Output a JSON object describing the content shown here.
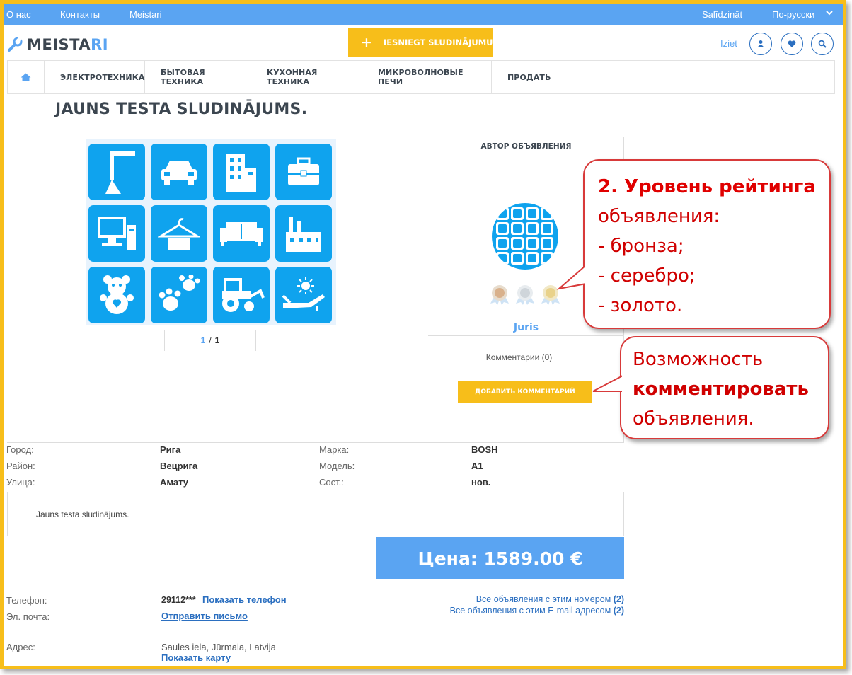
{
  "topbar": {
    "about": "О нас",
    "contacts": "Контакты",
    "brand_link": "Meistari",
    "compare": "Salīdzināt",
    "language": "По-русски"
  },
  "header": {
    "logo_text_main": "MEISTA",
    "logo_text_accent": "RI",
    "submit_ad": "IESNIEGT SLUDINĀJUMU",
    "logout": "Iziet"
  },
  "nav": {
    "items": [
      "ЭЛЕКТРОТЕХНИКА",
      "БЫТОВАЯ ТЕХНИКА",
      "КУХОННАЯ ТЕХНИКА",
      "МИКРОВОЛНОВЫЕ ПЕЧИ",
      "ПРОДАТЬ"
    ]
  },
  "ad": {
    "title": "JAUNS TESTA SLUDINĀJUMS.",
    "pager": {
      "current": "1",
      "separator": "/",
      "total": "1"
    },
    "gallery_icons": [
      "crane-icon",
      "car-icon",
      "building-icon",
      "briefcase-icon",
      "computer-icon",
      "hanger-icon",
      "sofa-icon",
      "factory-icon",
      "teddy-bear-icon",
      "paw-icon",
      "tractor-icon",
      "sunbed-icon"
    ],
    "description": "Jauns testa sludinājums.",
    "price": "Цена: 1589.00 €"
  },
  "author": {
    "header": "АВТОР ОБЪЯВЛЕНИЯ",
    "name": "Juris",
    "comments": "Комментарии (0)",
    "add_comment": "ДОБАВИТЬ КОММЕНТАРИЙ",
    "medals": [
      "bronze",
      "silver",
      "gold"
    ]
  },
  "callouts": {
    "rating_title": "2. Уровень рейтинга",
    "rating_lines": [
      "объявления:",
      "- бронза;",
      "- серебро;",
      "- золото."
    ],
    "comment_line1": "Возможность",
    "comment_line2": "комментировать",
    "comment_line3": "объявления."
  },
  "details": {
    "city_label": "Город:",
    "city": "Рига",
    "district_label": "Район:",
    "district": "Вецрига",
    "street_label": "Улица:",
    "street": "Амату",
    "brand_label": "Марка:",
    "brand": "BOSH",
    "model_label": "Модель:",
    "model": "A1",
    "condition_label": "Сост.:",
    "condition": "нов."
  },
  "contact": {
    "phone_label": "Телефон:",
    "phone": "29112***",
    "show_phone": "Показать телефон",
    "email_label": "Эл. почта:",
    "send_email": "Отправить письмо",
    "address_label": "Адрес:",
    "address": "Saules iela, Jūrmala, Latvija",
    "show_map": "Показать карту",
    "all_by_phone": "Все объявления с этим номером",
    "all_by_phone_count": "(2)",
    "all_by_email": "Все объявления с этим E-mail адресом",
    "all_by_email_count": "(2)"
  },
  "colors": {
    "accent_blue": "#5aa4f2",
    "tile_blue": "#0fa3ee",
    "accent_yellow": "#f7be1a",
    "callout_red": "#d00000"
  }
}
